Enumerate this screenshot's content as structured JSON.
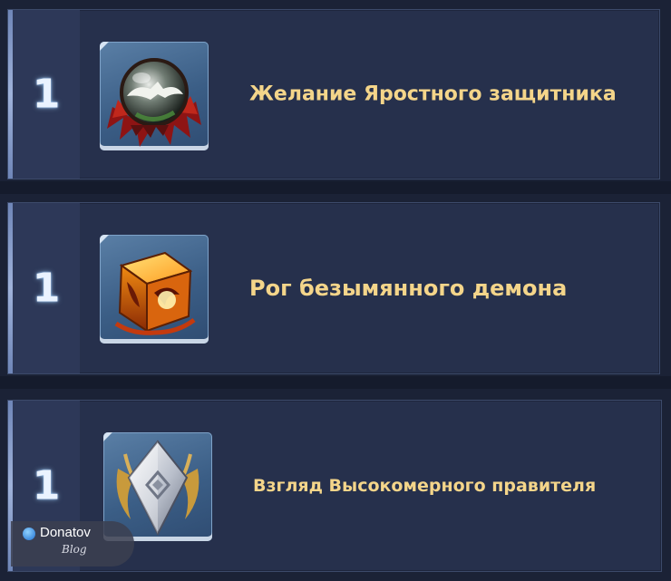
{
  "items": [
    {
      "rank": "1",
      "name": "Желание Яростного защитника",
      "icon": "dragon-orb-icon"
    },
    {
      "rank": "1",
      "name": "Рог безымянного демона",
      "icon": "demon-cube-icon"
    },
    {
      "rank": "1",
      "name": "Взгляд Высокомерного правителя",
      "icon": "silver-crystal-crest-icon"
    }
  ],
  "watermark": {
    "brand": "Donatov",
    "sub": "Blog"
  },
  "colors": {
    "item_name": "#f4d58a",
    "rank": "#eaf3ff",
    "row_bg": "#26304c"
  }
}
